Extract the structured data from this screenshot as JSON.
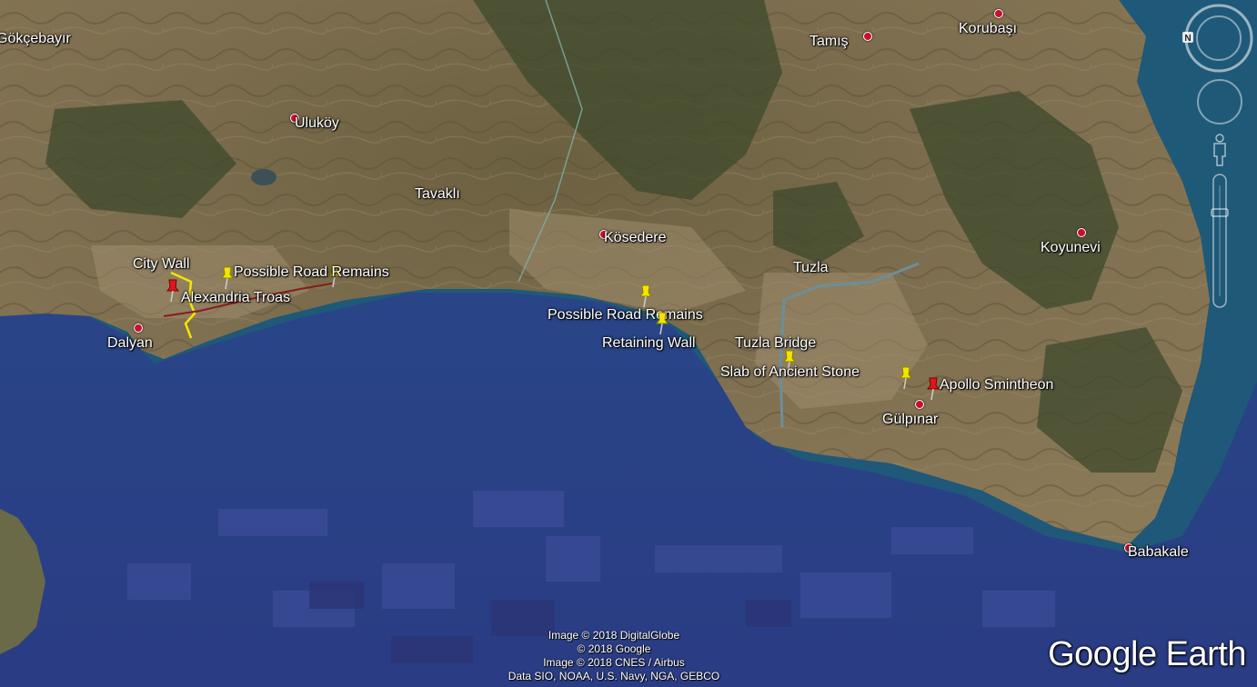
{
  "places": [
    {
      "id": "gokcebayir",
      "label": "Gökçebayır",
      "dot": false
    },
    {
      "id": "koruba",
      "label": "Korubaşı",
      "dot": true
    },
    {
      "id": "tamis",
      "label": "Tamış",
      "dot": true
    },
    {
      "id": "ulukoy",
      "label": "Uluköy",
      "dot": true
    },
    {
      "id": "tavakli",
      "label": "Tavaklı",
      "dot": false
    },
    {
      "id": "kosedere",
      "label": "Kösedere",
      "dot": true
    },
    {
      "id": "tuzla",
      "label": "Tuzla",
      "dot": false
    },
    {
      "id": "koyunevi",
      "label": "Koyunevi",
      "dot": true
    },
    {
      "id": "dalyan",
      "label": "Dalyan",
      "dot": true
    },
    {
      "id": "gulpinar",
      "label": "Gülpınar",
      "dot": true
    },
    {
      "id": "babakale",
      "label": "Babakale",
      "dot": true
    }
  ],
  "placemarks": [
    {
      "id": "city-wall",
      "label": "City Wall",
      "color": "#f2e600"
    },
    {
      "id": "alexandria-troas",
      "label": "Alexandria Troas",
      "color": "#e0161b"
    },
    {
      "id": "road-remains-1",
      "label": "Possible Road Remains",
      "color": "#f2e600"
    },
    {
      "id": "road-remains-2",
      "label": "Possible Road Remains",
      "color": "#f2e600"
    },
    {
      "id": "retaining-wall",
      "label": "Retaining Wall",
      "color": "#f2e600"
    },
    {
      "id": "tuzla-bridge",
      "label": "Tuzla Bridge",
      "color": "#f2e600"
    },
    {
      "id": "slab-stone",
      "label": "Slab of Ancient Stone",
      "color": "#f2e600"
    },
    {
      "id": "apollo-smintheon",
      "label": "Apollo Smintheon",
      "color": "#e0161b"
    }
  ],
  "attribution": [
    "Image © 2018 DigitalGlobe",
    "© 2018 Google",
    "Image © 2018 CNES / Airbus",
    "Data SIO, NOAA, U.S. Navy, NGA, GEBCO"
  ],
  "brand": "Google Earth",
  "compass_letter": "N",
  "colors": {
    "sea_deep": "#2b3f86",
    "sea_shallow": "#1f5a78",
    "land": "#7d6e4e",
    "forest": "#3b4a2b"
  }
}
